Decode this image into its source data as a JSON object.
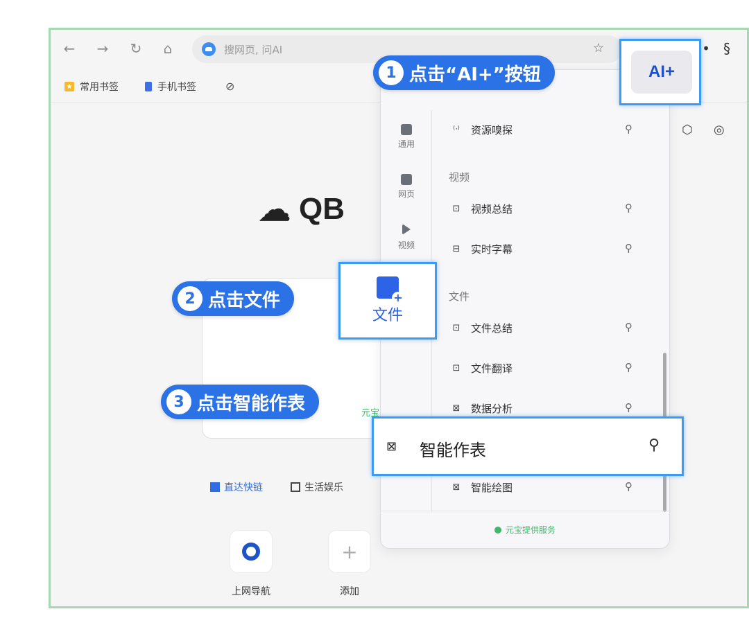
{
  "browser": {
    "address_placeholder": "搜网页, 问AI",
    "bookmarks": [
      "常用书签",
      "手机书签"
    ]
  },
  "logo_text": "QB",
  "yuanbao_label": "元宝",
  "home": {
    "categories": [
      "直达快链",
      "生活娱乐"
    ],
    "tiles": [
      "上网导航",
      "添加"
    ]
  },
  "panel": {
    "side_items": [
      "通用",
      "网页",
      "视频"
    ],
    "items": {
      "resource": "资源嗅探",
      "video_section": "视频",
      "video_summary": "视频总结",
      "realtime_subtitle": "实时字幕",
      "file_section": "文件",
      "file_summary": "文件总结",
      "file_translate": "文件翻译",
      "data_analysis": "数据分析",
      "smart_chart": "智能作表",
      "smart_draw": "智能绘图"
    },
    "footer": "元宝提供服务"
  },
  "highlights": {
    "aiplus": "AI+",
    "wenjian": "文件",
    "zhineng": "智能作表"
  },
  "callouts": [
    {
      "num": "1",
      "text": "点击“AI+”按钮"
    },
    {
      "num": "2",
      "text": "点击文件"
    },
    {
      "num": "3",
      "text": "点击智能作表"
    }
  ],
  "colors": {
    "accent": "#2a72e6",
    "highlight_border": "#3e9bf3",
    "frame_border": "#a6d9b3",
    "yuanbao_green": "#3fb86a"
  }
}
